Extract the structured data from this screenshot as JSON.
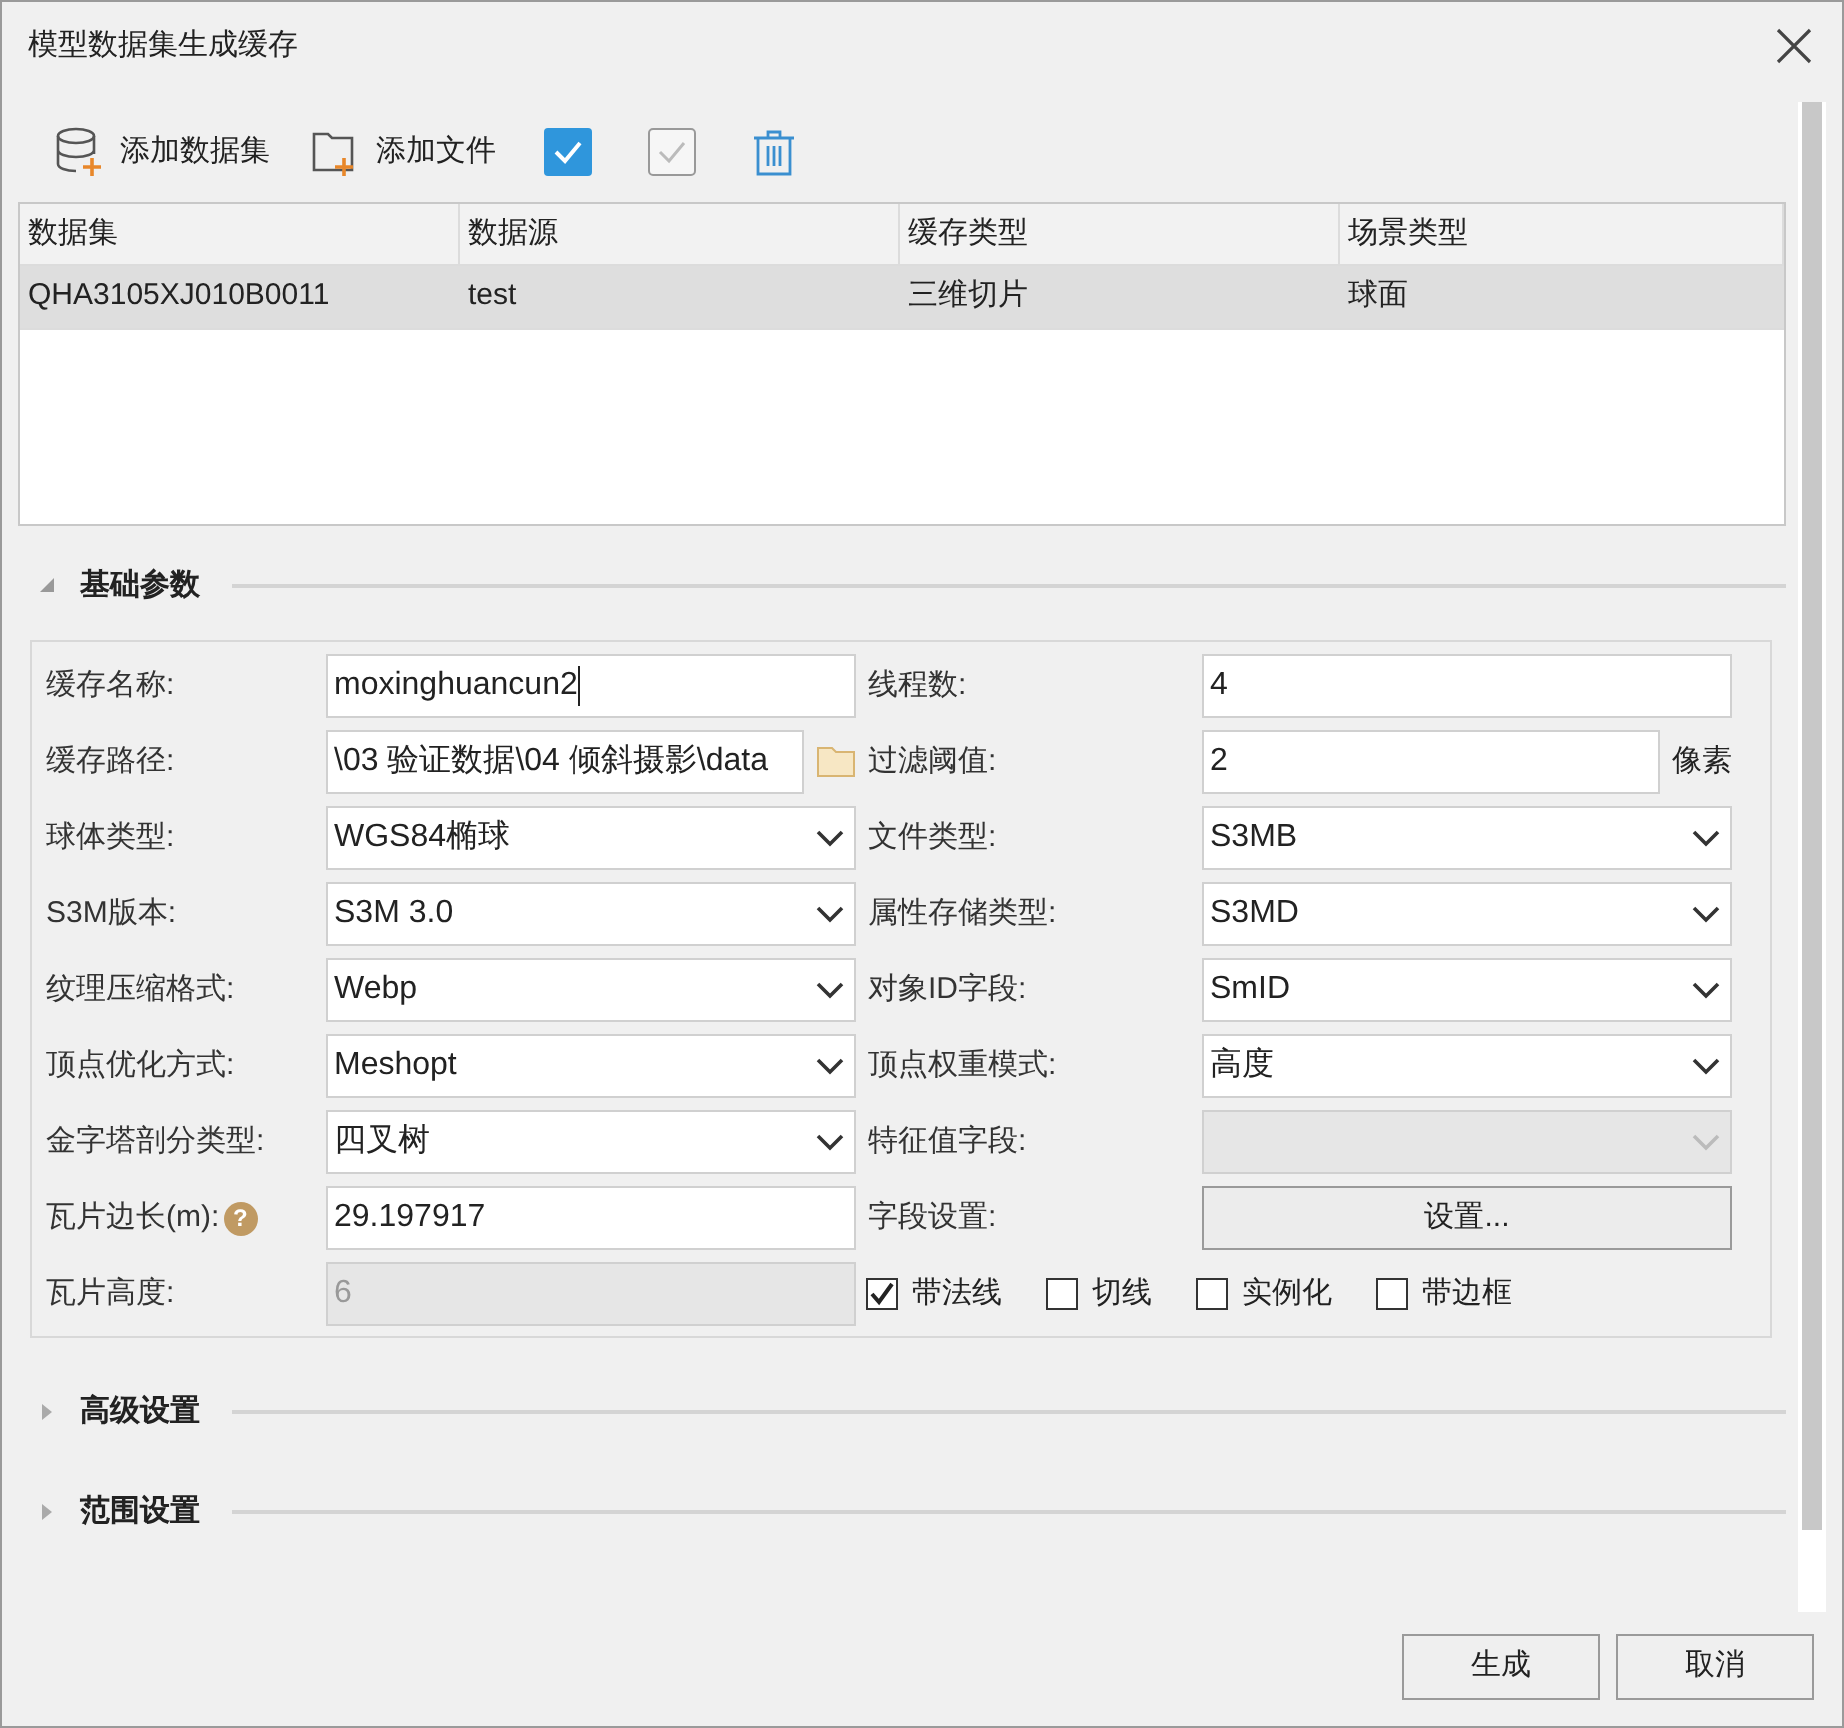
{
  "window": {
    "title": "模型数据集生成缓存"
  },
  "toolbar": [
    {
      "kind": "add-dataset",
      "label": "添加数据集"
    },
    {
      "kind": "add-file",
      "label": "添加文件"
    },
    {
      "kind": "select-all"
    },
    {
      "kind": "select-none"
    },
    {
      "kind": "delete"
    }
  ],
  "table": {
    "columns": [
      "数据集",
      "数据源",
      "缓存类型",
      "场景类型"
    ],
    "rows": [
      {
        "cells": [
          "QHA3105XJ010B0011",
          "test",
          "三维切片",
          "球面"
        ],
        "selected": true
      }
    ]
  },
  "sections": [
    {
      "title": "基础参数",
      "expanded": true,
      "left_fields": [
        {
          "kind": "text",
          "label": "缓存名称:",
          "value": "moxinghuancun2",
          "focused": true
        },
        {
          "kind": "path",
          "label": "缓存路径:",
          "value": "\\03 验证数据\\04 倾斜摄影\\data"
        },
        {
          "kind": "combo",
          "label": "球体类型:",
          "value": "WGS84椭球"
        },
        {
          "kind": "combo",
          "label": "S3M版本:",
          "value": "S3M 3.0"
        },
        {
          "kind": "combo",
          "label": "纹理压缩格式:",
          "value": "Webp"
        },
        {
          "kind": "combo",
          "label": "顶点优化方式:",
          "value": "Meshopt"
        },
        {
          "kind": "combo",
          "label": "金字塔剖分类型:",
          "value": "四叉树"
        },
        {
          "kind": "text",
          "label": "瓦片边长(m):",
          "help": "?",
          "value": "29.197917"
        },
        {
          "kind": "text",
          "label": "瓦片高度:",
          "value": "6",
          "disabled": true
        }
      ],
      "right_fields": [
        {
          "kind": "text",
          "label": "线程数:",
          "value": "4"
        },
        {
          "kind": "text",
          "label": "过滤阈值:",
          "value": "2",
          "unit": "像素"
        },
        {
          "kind": "combo",
          "label": "文件类型:",
          "value": "S3MB"
        },
        {
          "kind": "combo",
          "label": "属性存储类型:",
          "value": "S3MD"
        },
        {
          "kind": "combo",
          "label": "对象ID字段:",
          "value": "SmID"
        },
        {
          "kind": "combo",
          "label": "顶点权重模式:",
          "value": "高度"
        },
        {
          "kind": "combo",
          "label": "特征值字段:",
          "disabled": true
        },
        {
          "kind": "button",
          "label": "字段设置:",
          "value": "设置..."
        }
      ],
      "options": [
        {
          "label": "带法线",
          "checked": true
        },
        {
          "label": "切线",
          "checked": false
        },
        {
          "label": "实例化",
          "checked": false
        },
        {
          "label": "带边框",
          "checked": false
        }
      ]
    },
    {
      "title": "高级设置",
      "expanded": false
    },
    {
      "title": "范围设置",
      "expanded": false
    }
  ],
  "buttons": [
    "生成",
    "取消"
  ]
}
